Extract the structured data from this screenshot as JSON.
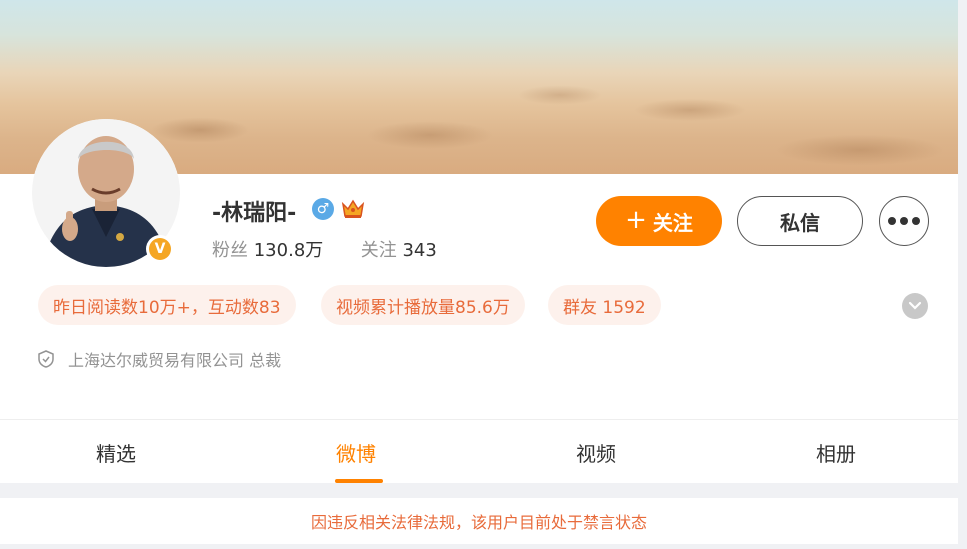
{
  "profile": {
    "name": "-林瑞阳-",
    "gender_symbol": "♂",
    "verified_symbol": "V",
    "fans_label": "粉丝",
    "fans_count": "130.8万",
    "following_label": "关注",
    "following_count": "343"
  },
  "actions": {
    "follow_plus": "+",
    "follow_label": "关注",
    "message_label": "私信"
  },
  "chips": [
    {
      "text": "昨日阅读数10万+，互动数83"
    },
    {
      "text": "视频累计播放量85.6万"
    },
    {
      "text": "群友 1592"
    }
  ],
  "company": "上海达尔威贸易有限公司 总裁",
  "tabs": [
    {
      "label": "精选"
    },
    {
      "label": "微博"
    },
    {
      "label": "视频"
    },
    {
      "label": "相册"
    }
  ],
  "active_tab": "微博",
  "notice": "因违反相关法律法规，该用户目前处于禁言状态",
  "colors": {
    "accent": "#ff8200",
    "chip_text": "#e86b3b",
    "chip_bg": "#fdf1ec",
    "gender_blue": "#5aa9e6",
    "verified_gold": "#f5a623"
  },
  "icons": {
    "gender": "male-icon",
    "crown": "crown-icon",
    "verified": "verified-badge-icon",
    "more": "more-icon",
    "expand": "chevron-down-icon",
    "shield": "shield-icon"
  }
}
